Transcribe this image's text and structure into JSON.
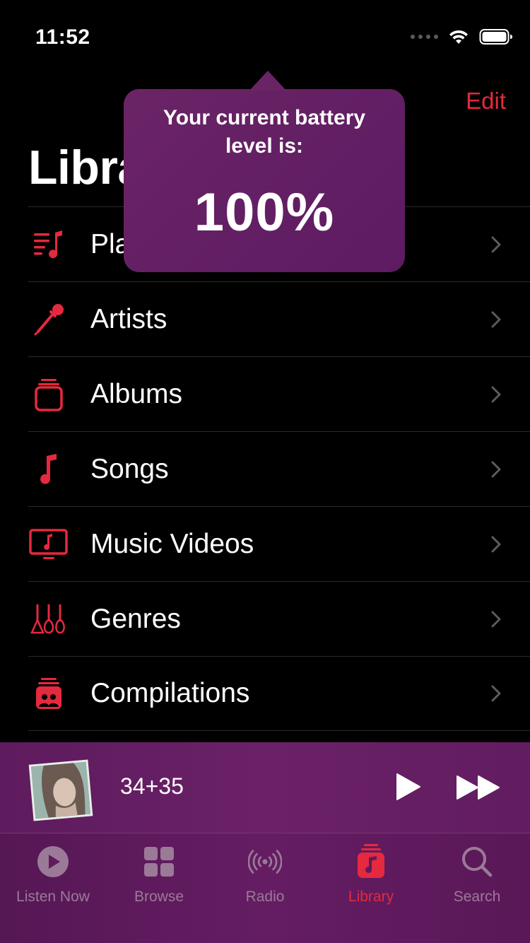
{
  "status_bar": {
    "time": "11:52"
  },
  "header": {
    "edit_label": "Edit",
    "title": "Library"
  },
  "tooltip": {
    "text": "Your current battery level is:",
    "value": "100%"
  },
  "library": {
    "items": [
      {
        "label": "Playlists",
        "icon": "playlist-icon"
      },
      {
        "label": "Artists",
        "icon": "microphone-icon"
      },
      {
        "label": "Albums",
        "icon": "album-stack-icon"
      },
      {
        "label": "Songs",
        "icon": "music-note-icon"
      },
      {
        "label": "Music Videos",
        "icon": "tv-music-icon"
      },
      {
        "label": "Genres",
        "icon": "guitars-icon"
      },
      {
        "label": "Compilations",
        "icon": "compilation-icon"
      }
    ]
  },
  "mini_player": {
    "track_title": "34+35"
  },
  "tab_bar": {
    "tabs": [
      {
        "label": "Listen Now",
        "icon": "play-circle-icon"
      },
      {
        "label": "Browse",
        "icon": "grid-icon"
      },
      {
        "label": "Radio",
        "icon": "broadcast-icon"
      },
      {
        "label": "Library",
        "icon": "library-note-icon",
        "active": true
      },
      {
        "label": "Search",
        "icon": "search-icon"
      }
    ]
  },
  "colors": {
    "accent": "#e5293e",
    "player_bg": "#6b2167",
    "tooltip_bg": "#6a2466"
  }
}
